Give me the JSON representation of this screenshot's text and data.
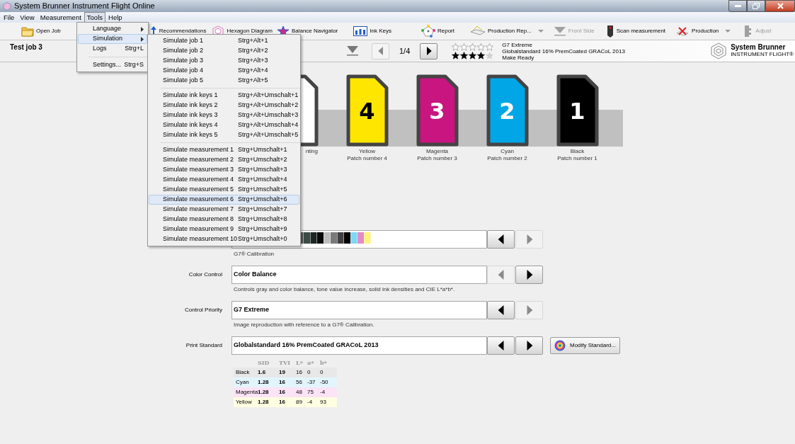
{
  "window": {
    "title": "System Brunner Instrument Flight Online"
  },
  "menu_bar": [
    {
      "label": "File",
      "selected": false
    },
    {
      "label": "View",
      "selected": false
    },
    {
      "label": "Measurement",
      "selected": false
    },
    {
      "label": "Tools",
      "selected": true
    },
    {
      "label": "Help",
      "selected": false
    }
  ],
  "tools_menu": [
    {
      "kind": "submenu",
      "label": "Language",
      "selected": false
    },
    {
      "kind": "submenu",
      "label": "Simulation",
      "selected": true
    },
    {
      "kind": "item",
      "label": "Logs",
      "shortcut": "Strg+L",
      "selected": false
    },
    {
      "kind": "separator"
    },
    {
      "kind": "item",
      "label": "Settings...",
      "shortcut": "Strg+S",
      "selected": false
    }
  ],
  "simulation_menu": [
    [
      {
        "label": "Simulate job 1",
        "shortcut": "Strg+Alt+1",
        "selected": false
      },
      {
        "label": "Simulate job 2",
        "shortcut": "Strg+Alt+2",
        "selected": false
      },
      {
        "label": "Simulate job 3",
        "shortcut": "Strg+Alt+3",
        "selected": false
      },
      {
        "label": "Simulate job 4",
        "shortcut": "Strg+Alt+4",
        "selected": false
      },
      {
        "label": "Simulate job 5",
        "shortcut": "Strg+Alt+5",
        "selected": false
      }
    ],
    [
      {
        "label": "Simulate ink keys 1",
        "shortcut": "Strg+Alt+Umschalt+1",
        "selected": false
      },
      {
        "label": "Simulate ink keys 2",
        "shortcut": "Strg+Alt+Umschalt+2",
        "selected": false
      },
      {
        "label": "Simulate ink keys 3",
        "shortcut": "Strg+Alt+Umschalt+3",
        "selected": false
      },
      {
        "label": "Simulate ink keys 4",
        "shortcut": "Strg+Alt+Umschalt+4",
        "selected": false
      },
      {
        "label": "Simulate ink keys 5",
        "shortcut": "Strg+Alt+Umschalt+5",
        "selected": false
      }
    ],
    [
      {
        "label": "Simulate measurement 1",
        "shortcut": "Strg+Umschalt+1",
        "selected": false
      },
      {
        "label": "Simulate measurement 2",
        "shortcut": "Strg+Umschalt+2",
        "selected": false
      },
      {
        "label": "Simulate measurement 3",
        "shortcut": "Strg+Umschalt+3",
        "selected": false
      },
      {
        "label": "Simulate measurement 4",
        "shortcut": "Strg+Umschalt+4",
        "selected": false
      },
      {
        "label": "Simulate measurement 5",
        "shortcut": "Strg+Umschalt+5",
        "selected": false
      },
      {
        "label": "Simulate measurement 6",
        "shortcut": "Strg+Umschalt+6",
        "selected": true
      },
      {
        "label": "Simulate measurement 7",
        "shortcut": "Strg+Umschalt+7",
        "selected": false
      },
      {
        "label": "Simulate measurement 8",
        "shortcut": "Strg+Umschalt+8",
        "selected": false
      },
      {
        "label": "Simulate measurement 9",
        "shortcut": "Strg+Umschalt+9",
        "selected": false
      },
      {
        "label": "Simulate measurement 10",
        "shortcut": "Strg+Umschalt+0",
        "selected": false
      }
    ]
  ],
  "toolbar": [
    {
      "label": "Open Job",
      "disabled": false,
      "dropdown": false
    },
    {
      "label": "Recommendations",
      "disabled": false,
      "dropdown": false
    },
    {
      "label": "Hexagon Diagram",
      "disabled": false,
      "dropdown": false
    },
    {
      "label": "Balance Navigator",
      "disabled": false,
      "dropdown": false
    },
    {
      "label": "Ink Keys",
      "disabled": false,
      "dropdown": false
    },
    {
      "label": "Report",
      "disabled": false,
      "dropdown": false
    },
    {
      "label": "Production Rep...",
      "disabled": false,
      "dropdown": true
    },
    {
      "label": "Front Side",
      "disabled": true,
      "dropdown": false
    },
    {
      "label": "Scan measurement",
      "disabled": false,
      "dropdown": false
    },
    {
      "label": "Production",
      "disabled": false,
      "dropdown": true
    },
    {
      "label": "Adjust",
      "disabled": true,
      "dropdown": false
    }
  ],
  "job_bar": {
    "title": "Test job 3",
    "page": "1/4",
    "prev_disabled": true,
    "next_disabled": false,
    "ratings": [
      {
        "kind": "outline",
        "stars": 0
      },
      {
        "kind": "solid",
        "stars": 4
      }
    ],
    "info": [
      "G7 Extreme",
      "Globalstandard 16% PremCoated GRACoL 2013",
      "Make Ready"
    ],
    "brand": {
      "name": "System Brunner",
      "subtitle": "INSTRUMENT FLIGHT®"
    }
  },
  "patches": [
    {
      "label": "nting",
      "color": "#ffffff"
    },
    {
      "number": "4",
      "label": "Yellow",
      "sublabel": "Patch number 4",
      "color": "#ffe600"
    },
    {
      "number": "3",
      "label": "Magenta",
      "sublabel": "Patch number 3",
      "color": "#c8157f"
    },
    {
      "number": "2",
      "label": "Cyan",
      "sublabel": "Patch number 2",
      "color": "#00a6e6"
    },
    {
      "number": "1",
      "label": "Black",
      "sublabel": "Patch number 1",
      "color": "#000000"
    }
  ],
  "settings": [
    {
      "kind": "strip",
      "description": "G7® Calibration",
      "prev_disabled": false,
      "next_disabled": true
    },
    {
      "kind": "text",
      "label": "Color Control",
      "value": "Color Balance",
      "description": "Controls gray and color balance, tone value increase, solid ink densities and CIE L*a*b*.",
      "prev_disabled": true,
      "next_disabled": false
    },
    {
      "kind": "text",
      "label": "Control Priority",
      "value": "G7 Extreme",
      "description": "Image reproduction with reference to a G7® Calibration.",
      "prev_disabled": false,
      "next_disabled": true
    },
    {
      "kind": "text",
      "label": "Print Standard",
      "value": "Globalstandard 16% PremCoated GRACoL 2013",
      "prev_disabled": false,
      "next_disabled": false,
      "action": "Modify Standard..."
    }
  ],
  "table": {
    "columns": [
      "SID",
      "TVI",
      "L*",
      "a*",
      "b*"
    ],
    "rows": [
      {
        "name": "Black",
        "color": "#e8e8e8",
        "cells": [
          "1.6",
          "19",
          "16",
          "0",
          "0"
        ]
      },
      {
        "name": "Cyan",
        "color": "#e2f5fd",
        "cells": [
          "1.28",
          "16",
          "56",
          "-37",
          "-50"
        ]
      },
      {
        "name": "Magenta",
        "color": "#fce3f6",
        "cells": [
          "1.28",
          "16",
          "48",
          "75",
          "-4"
        ]
      },
      {
        "name": "Yellow",
        "color": "#fefee2",
        "cells": [
          "1.28",
          "16",
          "89",
          "-4",
          "93"
        ]
      }
    ]
  }
}
